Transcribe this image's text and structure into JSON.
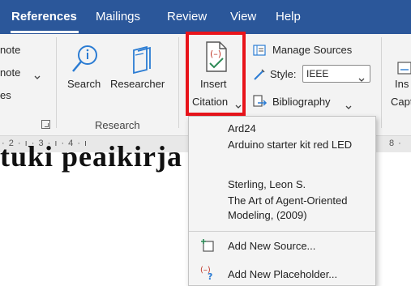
{
  "tabs": [
    "References",
    "Mailings",
    "Review",
    "View",
    "Help"
  ],
  "ribbon": {
    "footnotes": {
      "line1": "note",
      "line2": "note",
      "line3": "es"
    },
    "research": {
      "search_label": "Search",
      "researcher_label": "Researcher",
      "group_label": "Research"
    },
    "citations": {
      "insert_line1": "Insert",
      "insert_line2": "Citation",
      "manage_sources": "Manage Sources",
      "style_label": "Style:",
      "style_value": "IEEE",
      "bibliography": "Bibliography"
    },
    "captions": {
      "line1": "Ins",
      "line2": "Capt"
    }
  },
  "ruler": {
    "text": "· 2 · ı · 3 · ı · 4 · ı",
    "right_text": "8 ·"
  },
  "document": {
    "visible_text": "tuki peaikirja"
  },
  "dropdown": {
    "sources": [
      {
        "line1": "Ard24",
        "line2": "Arduino starter kit red LED"
      },
      {
        "line1": "Sterling, Leon S.",
        "line2": "The Art of Agent-Oriented",
        "line3": "Modeling, (2009)"
      }
    ],
    "add_new_source": "Add New Source...",
    "add_new_placeholder": "Add New Placeholder..."
  },
  "colors": {
    "titlebar": "#2b579a",
    "highlight": "#e8141b",
    "accent": "#2b7cd3"
  }
}
